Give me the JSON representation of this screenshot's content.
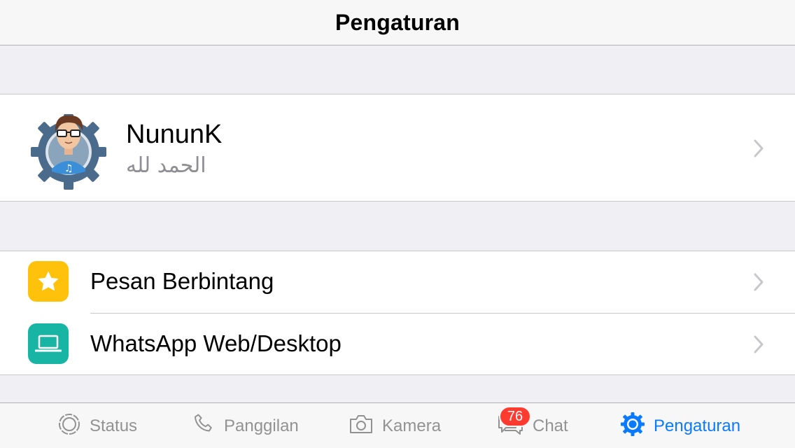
{
  "navbar": {
    "title": "Pengaturan"
  },
  "profile": {
    "name": "NununK",
    "status": "الحمد لله",
    "avatar_icon": "avatar-gear-icon"
  },
  "menu": [
    {
      "label": "Pesan Berbintang",
      "icon": "star-icon",
      "icon_bg": "#fec20b"
    },
    {
      "label": "WhatsApp Web/Desktop",
      "icon": "laptop-icon",
      "icon_bg": "#19b5a4"
    }
  ],
  "tabbar": {
    "tabs": [
      {
        "label": "Status",
        "icon": "status-icon",
        "active": false
      },
      {
        "label": "Panggilan",
        "icon": "phone-icon",
        "active": false
      },
      {
        "label": "Kamera",
        "icon": "camera-icon",
        "active": false
      },
      {
        "label": "Chat",
        "icon": "chat-icon",
        "active": false,
        "badge": "76"
      },
      {
        "label": "Pengaturan",
        "icon": "settings-icon",
        "active": true
      }
    ]
  },
  "colors": {
    "accent": "#0a7aff",
    "badge": "#ff3b30",
    "background": "#efeff4"
  }
}
